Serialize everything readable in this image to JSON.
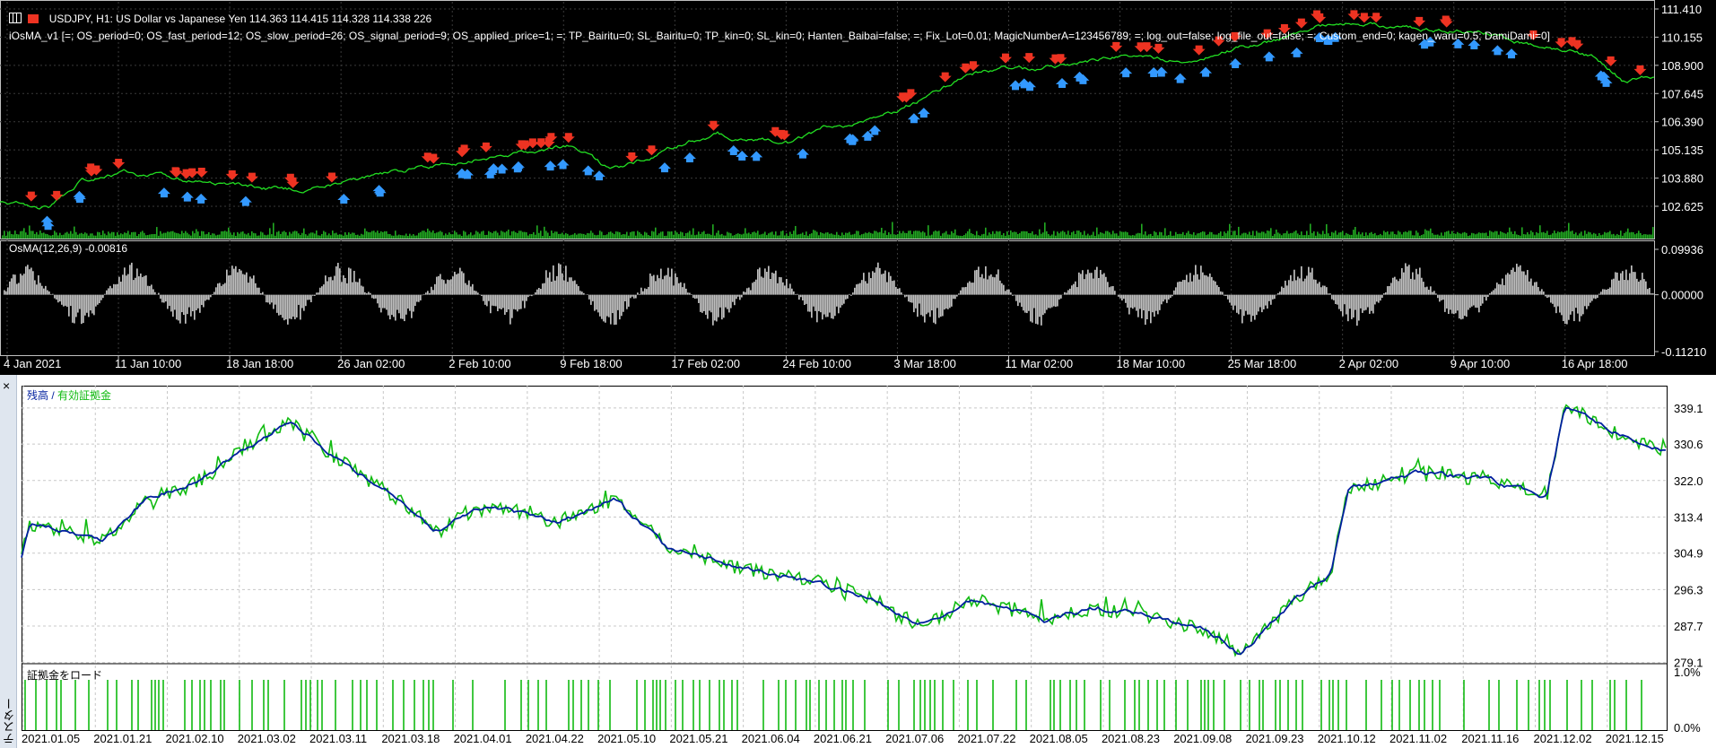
{
  "price_panel": {
    "header": "USDJPY, H1:  US Dollar vs Japanese Yen  114.363 114.415 114.328 114.338  226",
    "ea_params": "iOsMA_v1 [=; OS_period=0; OS_fast_period=12; OS_slow_period=26; OS_signal_period=9; OS_applied_price=1; =; TP_Bairitu=0; SL_Bairitu=0; TP_kin=0; SL_kin=0; Hanten_Baibai=false; =; Fix_Lot=0.01; MagicNumberA=123456789; =; log_out=false; log_file_out=false; =; Custom_end=0; kagen_waru=0.5;  DamiDami=0]",
    "price_scale": [
      "111.410",
      "110.155",
      "108.900",
      "107.645",
      "106.390",
      "105.135",
      "103.880",
      "102.625"
    ],
    "osma_label": "OsMA(12,26,9) -0.00816",
    "osma_scale": [
      "0.09936",
      "0.00000",
      "-0.11210"
    ],
    "time_axis": [
      "4 Jan 2021",
      "11 Jan 10:00",
      "18 Jan 18:00",
      "26 Jan 02:00",
      "2 Feb 10:00",
      "9 Feb 18:00",
      "17 Feb 02:00",
      "24 Feb 10:00",
      "3 Mar 18:00",
      "11 Mar 02:00",
      "18 Mar 10:00",
      "25 Mar 18:00",
      "2 Apr 02:00",
      "9 Apr 10:00",
      "16 Apr 18:00"
    ]
  },
  "tester_panel": {
    "close_label": "×",
    "sidebar_label": "テスター",
    "legend_balance": "残高",
    "legend_sep": " / ",
    "legend_equity": "有効証拠金",
    "balance_scale": [
      "339.1",
      "330.6",
      "322.0",
      "313.4",
      "304.9",
      "296.3",
      "287.7",
      "279.1"
    ],
    "margin_label": "証拠金をロード",
    "margin_scale": [
      "1.0%",
      "0.0%"
    ],
    "date_axis": [
      "2021.01.05",
      "2021.01.21",
      "2021.02.10",
      "2021.03.02",
      "2021.03.11",
      "2021.03.18",
      "2021.04.01",
      "2021.04.22",
      "2021.05.10",
      "2021.05.21",
      "2021.06.04",
      "2021.06.21",
      "2021.07.06",
      "2021.07.22",
      "2021.08.05",
      "2021.08.23",
      "2021.09.08",
      "2021.09.23",
      "2021.10.12",
      "2021.11.02",
      "2021.11.16",
      "2021.12.02",
      "2021.12.15"
    ]
  },
  "colors": {
    "price_line": "#22dd22",
    "buy_arrow": "#3399ff",
    "sell_arrow": "#ee3322",
    "osma_hist": "#c0c0c0",
    "volume": "#22aa22",
    "balance": "#001f9e",
    "equity": "#11bb11",
    "margin_bar": "#11bb11"
  }
}
